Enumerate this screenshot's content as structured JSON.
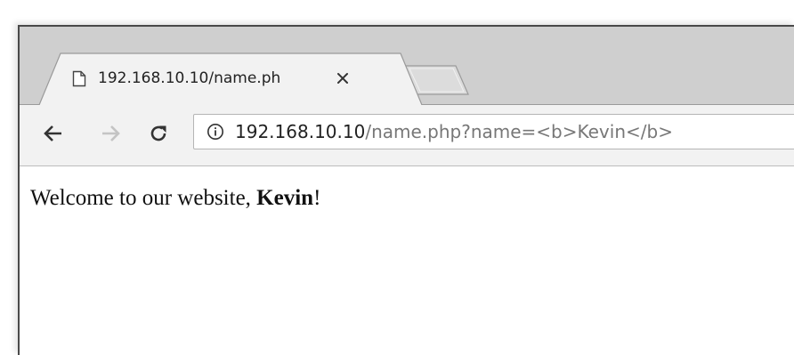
{
  "browser": {
    "tab": {
      "title": "192.168.10.10/name.ph",
      "close_symbol": "×",
      "favicon": "page-icon"
    },
    "toolbar": {
      "back": "back-arrow-icon",
      "forward": "forward-arrow-icon",
      "reload": "reload-icon"
    },
    "omnibox": {
      "info": "info-icon",
      "host": "192.168.10.10",
      "path": "/name.php?name=<b>Kevin</b>"
    }
  },
  "page": {
    "greeting_prefix": "Welcome to our website, ",
    "name": "Kevin",
    "greeting_suffix": "!"
  },
  "colors": {
    "tabstrip": "#cfcfcf",
    "toolbar": "#f2f2f2",
    "url_host": "#222222",
    "url_path": "#777777"
  }
}
